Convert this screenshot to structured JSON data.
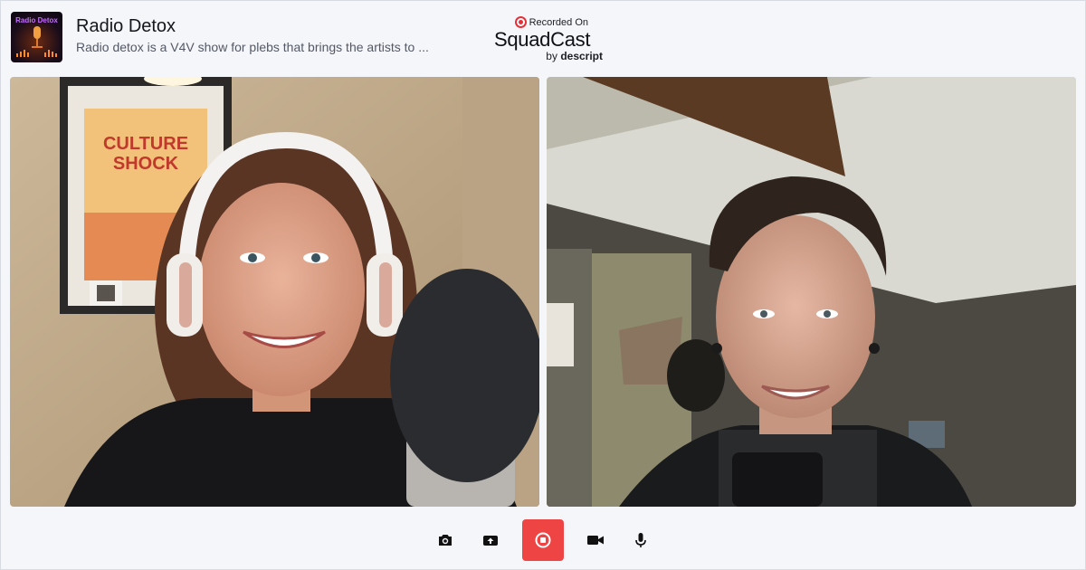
{
  "show": {
    "logo_text": "Radio Detox",
    "title": "Radio Detox",
    "description": "Radio detox is a V4V show for plebs that brings the artists to ..."
  },
  "branding": {
    "recorded_on": "Recorded On",
    "name": "SquadCast",
    "by": "by",
    "company": "descript"
  },
  "participants": [
    {
      "poster_line1": "CULTURE",
      "poster_line2": "SHOCK"
    },
    {}
  ],
  "controls": [
    {
      "name": "camera-snapshot",
      "icon": "camera-icon"
    },
    {
      "name": "upload",
      "icon": "upload-icon"
    },
    {
      "name": "stop-recording",
      "icon": "stop-icon"
    },
    {
      "name": "video-toggle",
      "icon": "video-camera-icon"
    },
    {
      "name": "mic-toggle",
      "icon": "microphone-icon"
    }
  ],
  "colors": {
    "record_red": "#ef4444",
    "brand_red": "#e5303a",
    "background": "#f5f6fa"
  }
}
